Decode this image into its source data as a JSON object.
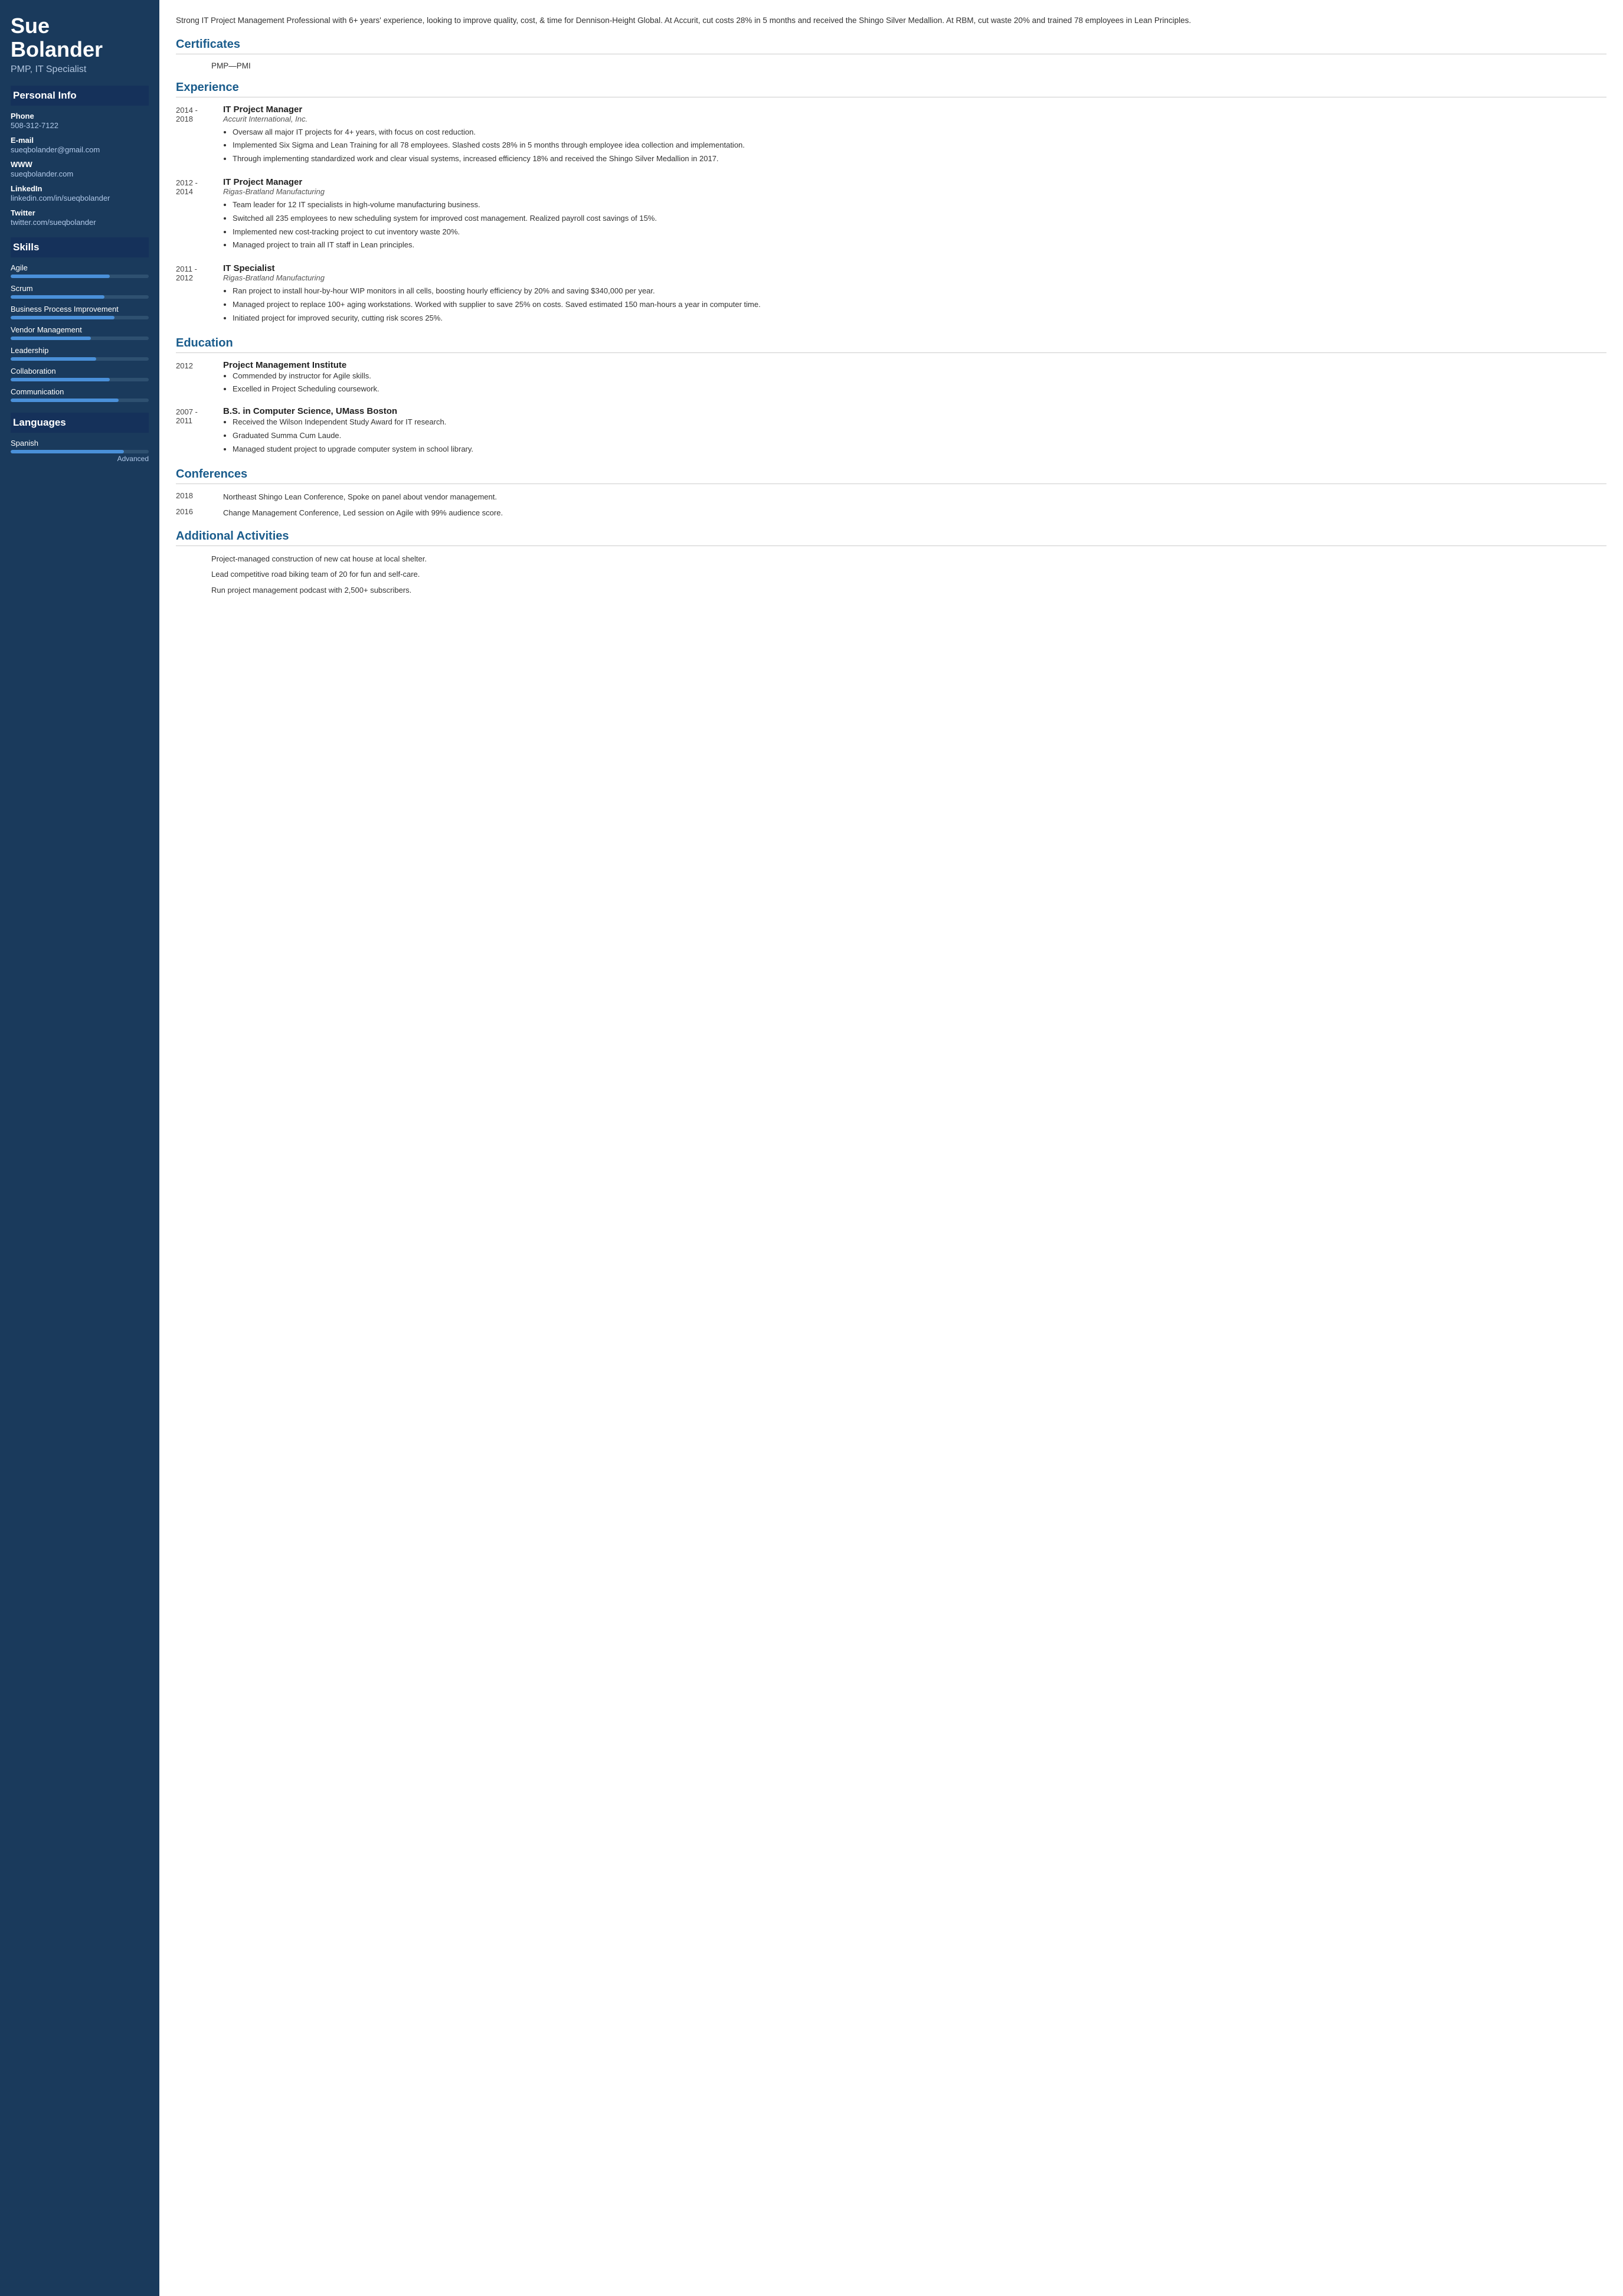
{
  "sidebar": {
    "name_line1": "Sue",
    "name_line2": "Bolander",
    "title": "PMP, IT Specialist",
    "personal_info_label": "Personal Info",
    "phone_label": "Phone",
    "phone_value": "508-312-7122",
    "email_label": "E-mail",
    "email_value": "sueqbolander@gmail.com",
    "www_label": "WWW",
    "www_value": "sueqbolander.com",
    "linkedin_label": "LinkedIn",
    "linkedin_value": "linkedin.com/in/sueqbolander",
    "twitter_label": "Twitter",
    "twitter_value": "twitter.com/sueqbolander",
    "skills_label": "Skills",
    "languages_label": "Languages",
    "skills": [
      {
        "name": "Agile",
        "pct": 72
      },
      {
        "name": "Scrum",
        "pct": 68
      },
      {
        "name": "Business Process Improvement",
        "pct": 75
      },
      {
        "name": "Vendor Management",
        "pct": 58
      },
      {
        "name": "Leadership",
        "pct": 62
      },
      {
        "name": "Collaboration",
        "pct": 72
      },
      {
        "name": "Communication",
        "pct": 78
      }
    ],
    "languages": [
      {
        "name": "Spanish",
        "pct": 82,
        "level": "Advanced"
      }
    ]
  },
  "main": {
    "summary": "Strong IT Project Management Professional with 6+ years' experience, looking to improve quality, cost, & time for Dennison-Height Global. At Accurit, cut costs 28% in 5 months and received the Shingo Silver Medallion. At RBM, cut waste 20% and trained 78 employees in Lean Principles.",
    "certificates_label": "Certificates",
    "cert_items": [
      "PMP—PMI"
    ],
    "experience_label": "Experience",
    "experience": [
      {
        "date": "2014 -\n2018",
        "title": "IT Project Manager",
        "company": "Accurit International, Inc.",
        "bullets": [
          "Oversaw all major IT projects for 4+ years, with focus on cost reduction.",
          "Implemented Six Sigma and Lean Training for all 78 employees. Slashed costs 28% in 5 months through employee idea collection and implementation.",
          "Through implementing standardized work and clear visual systems, increased efficiency 18% and received the Shingo Silver Medallion in 2017."
        ]
      },
      {
        "date": "2012 -\n2014",
        "title": "IT Project Manager",
        "company": "Rigas-Bratland Manufacturing",
        "bullets": [
          "Team leader for 12 IT specialists in high-volume manufacturing business.",
          "Switched all 235 employees to new scheduling system for improved cost management. Realized payroll cost savings of 15%.",
          "Implemented new cost-tracking project to cut inventory waste 20%.",
          "Managed project to train all IT staff in Lean principles."
        ]
      },
      {
        "date": "2011 -\n2012",
        "title": "IT Specialist",
        "company": "Rigas-Bratland Manufacturing",
        "bullets": [
          "Ran project to install hour-by-hour WIP monitors in all cells, boosting hourly efficiency by 20% and saving $340,000 per year.",
          "Managed project to replace 100+ aging workstations. Worked with supplier to save 25% on costs. Saved estimated 150 man-hours a year in computer time.",
          "Initiated project for improved security, cutting risk scores 25%."
        ]
      }
    ],
    "education_label": "Education",
    "education": [
      {
        "date": "2012",
        "school": "Project Management Institute",
        "bullets": [
          "Commended by instructor for Agile skills.",
          "Excelled in Project Scheduling coursework."
        ]
      },
      {
        "date": "2007 -\n2011",
        "school": "B.S. in Computer Science, UMass Boston",
        "bullets": [
          "Received the Wilson Independent Study Award for IT research.",
          "Graduated Summa Cum Laude.",
          "Managed student project to upgrade computer system in school library."
        ]
      }
    ],
    "conferences_label": "Conferences",
    "conferences": [
      {
        "date": "2018",
        "text": "Northeast Shingo Lean Conference, Spoke on panel about vendor management."
      },
      {
        "date": "2016",
        "text": "Change Management Conference, Led session on Agile with 99% audience score."
      }
    ],
    "activities_label": "Additional Activities",
    "activities": [
      "Project-managed construction of new cat house at local shelter.",
      "Lead competitive road biking team of 20 for fun and self-care.",
      "Run project management podcast with 2,500+ subscribers."
    ]
  }
}
